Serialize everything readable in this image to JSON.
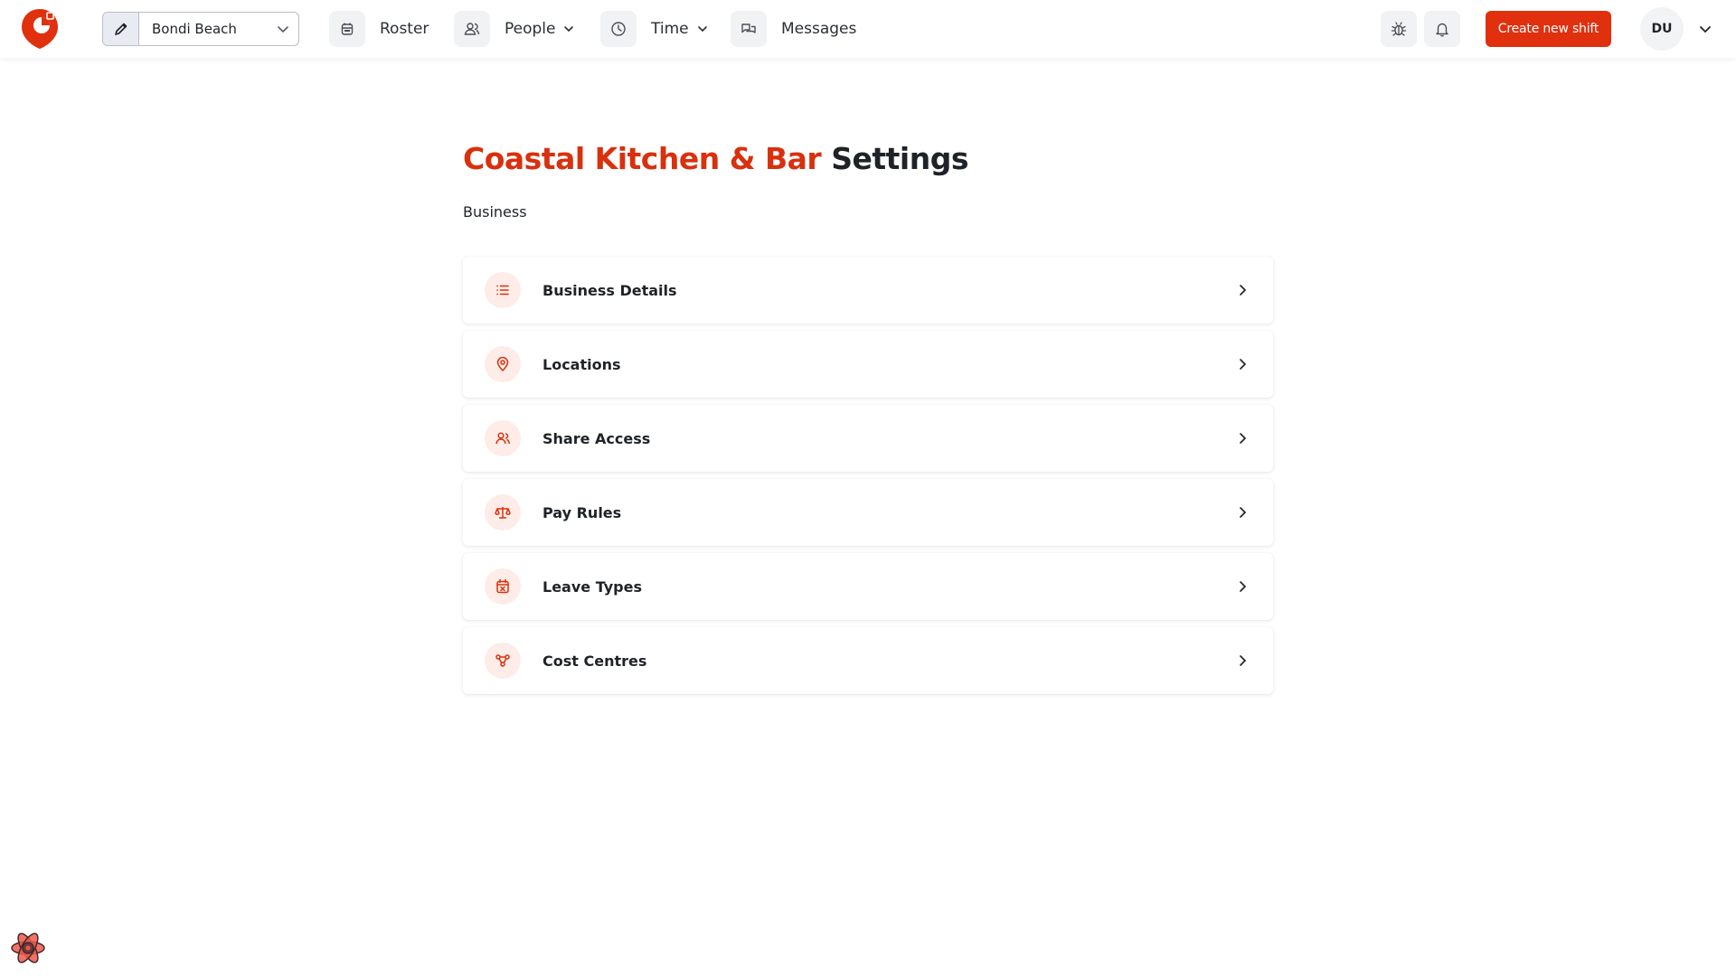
{
  "brand_color": "#e0300d",
  "header": {
    "logo_icon": "app-logo-icon",
    "location_select": {
      "value": "Bondi Beach",
      "edit_icon": "pencil-icon",
      "chevron_icon": "chevron-down-icon"
    },
    "nav": [
      {
        "label": "Roster",
        "icon": "calendar-icon"
      },
      {
        "label": "People",
        "icon": "users-icon",
        "dropdown": true
      },
      {
        "label": "Time",
        "icon": "clock-icon",
        "dropdown": true
      },
      {
        "label": "Messages",
        "icon": "chat-bubbles-icon"
      }
    ],
    "bug_icon": "bug-icon",
    "bell_icon": "bell-icon",
    "create_button": "Create new shift",
    "avatar_initials": "DU"
  },
  "page": {
    "title_brand": "Coastal Kitchen & Bar",
    "title_rest": "Settings",
    "section_label": "Business",
    "items": [
      {
        "label": "Business Details",
        "icon": "list-icon"
      },
      {
        "label": "Locations",
        "icon": "map-pin-icon"
      },
      {
        "label": "Share Access",
        "icon": "users-share-icon"
      },
      {
        "label": "Pay Rules",
        "icon": "scale-icon"
      },
      {
        "label": "Leave Types",
        "icon": "calendar-x-icon"
      },
      {
        "label": "Cost Centres",
        "icon": "nodes-icon"
      }
    ]
  },
  "dev_tools_icon": "react-devtools-icon"
}
